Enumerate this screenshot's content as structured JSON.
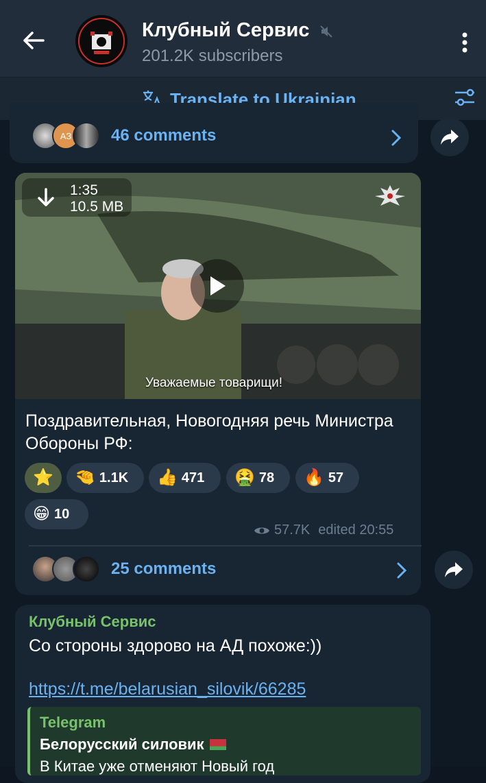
{
  "header": {
    "title": "Клубный Сервис",
    "subscribers": "201.2K subscribers"
  },
  "translate": {
    "label": "Translate to Ukrainian"
  },
  "post1": {
    "comments_label": "46 comments"
  },
  "post2": {
    "video_duration": "1:35",
    "video_size": "10.5 MB",
    "video_subtitle": "Уважаемые товарищи!",
    "text": "Поздравительная, Новогодняя речь Министра Обороны РФ:",
    "reactions": [
      {
        "emoji": "⭐",
        "count": ""
      },
      {
        "emoji": "🤏",
        "count": "1.1K"
      },
      {
        "emoji": "👍",
        "count": "471"
      },
      {
        "emoji": "🤮",
        "count": "78"
      },
      {
        "emoji": "🔥",
        "count": "57"
      },
      {
        "emoji": "😁",
        "count": "10"
      }
    ],
    "views": "57.7K",
    "edited": "edited 20:55",
    "comments_label": "25 comments"
  },
  "post3": {
    "author": "Клубный Сервис",
    "text": "Со стороны здорово на АД похоже:))",
    "link": "https://t.me/belarusian_silovik/66285",
    "preview": {
      "site": "Telegram",
      "title": "Белорусский силовик",
      "description": "В Китае уже отменяют Новый год"
    }
  },
  "colors": {
    "accent": "#6ab2f2",
    "author_green": "#79c26c",
    "bubble": "#182533",
    "header": "#212d3b"
  }
}
